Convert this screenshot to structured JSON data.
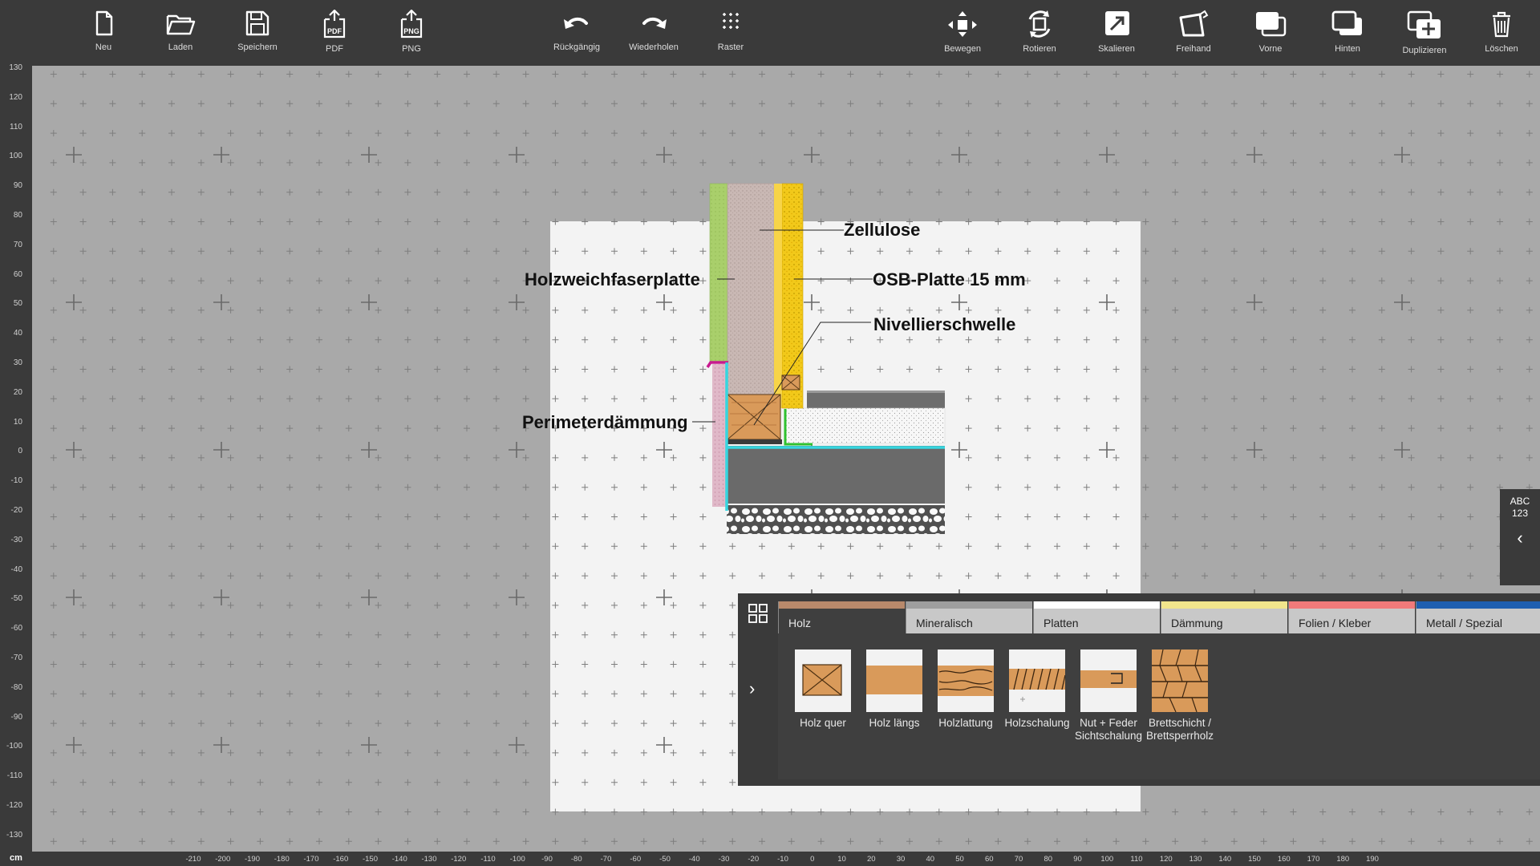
{
  "toolbar": {
    "left": [
      {
        "label": "Neu",
        "icon": "new-file-icon"
      },
      {
        "label": "Laden",
        "icon": "folder-open-icon"
      },
      {
        "label": "Speichern",
        "icon": "save-icon"
      },
      {
        "label": "PDF",
        "icon": "pdf-export-icon"
      },
      {
        "label": "PNG",
        "icon": "png-export-icon"
      }
    ],
    "middle": [
      {
        "label": "Rückgängig",
        "icon": "undo-icon"
      },
      {
        "label": "Wiederholen",
        "icon": "redo-icon"
      },
      {
        "label": "Raster",
        "icon": "grid-icon"
      }
    ],
    "right": [
      {
        "label": "Bewegen",
        "icon": "move-icon"
      },
      {
        "label": "Rotieren",
        "icon": "rotate-icon"
      },
      {
        "label": "Skalieren",
        "icon": "scale-icon"
      },
      {
        "label": "Freihand",
        "icon": "freehand-icon"
      },
      {
        "label": "Vorne",
        "icon": "bring-front-icon"
      },
      {
        "label": "Hinten",
        "icon": "send-back-icon"
      },
      {
        "label": "Duplizieren",
        "icon": "duplicate-icon"
      },
      {
        "label": "Löschen",
        "icon": "trash-icon"
      }
    ]
  },
  "ruler": {
    "unit": "cm",
    "vertical": [
      "130",
      "120",
      "110",
      "100",
      "90",
      "80",
      "70",
      "60",
      "50",
      "40",
      "30",
      "20",
      "10",
      "0",
      "-10",
      "-20",
      "-30",
      "-40",
      "-50",
      "-60",
      "-70",
      "-80",
      "-90",
      "-100",
      "-110",
      "-120",
      "-130"
    ],
    "horizontal": [
      "-210",
      "-200",
      "-190",
      "-180",
      "-170",
      "-160",
      "-150",
      "-140",
      "-130",
      "-120",
      "-110",
      "-100",
      "-90",
      "-80",
      "-70",
      "-60",
      "-50",
      "-40",
      "-30",
      "-20",
      "-10",
      "0",
      "10",
      "20",
      "30",
      "40",
      "50",
      "60",
      "70",
      "80",
      "90",
      "100",
      "110",
      "120",
      "130",
      "140",
      "150",
      "160",
      "170",
      "180",
      "190"
    ]
  },
  "drawing": {
    "labels": {
      "zellulose": "Zellulose",
      "osb": "OSB-Platte 15 mm",
      "holzweich": "Holzweichfaserplatte",
      "nivellier": "Nivellierschwelle",
      "perimeter": "Perimeterdämmung"
    }
  },
  "side_tab": {
    "line1": "ABC",
    "line2": "123",
    "arrow": "‹"
  },
  "panel": {
    "arrow": "›",
    "tabs": [
      {
        "label": "Holz",
        "color": "#b8896b",
        "active": true
      },
      {
        "label": "Mineralisch",
        "color": "#9e9e9e",
        "active": false
      },
      {
        "label": "Platten",
        "color": "#ffffff",
        "active": false
      },
      {
        "label": "Dämmung",
        "color": "#f1e58c",
        "active": false
      },
      {
        "label": "Folien / Kleber",
        "color": "#f07a7a",
        "active": false
      },
      {
        "label": "Metall / Spezial",
        "color": "#1f5fb0",
        "active": false
      }
    ],
    "items": [
      {
        "label": "Holz quer",
        "pattern": "crossed-timber"
      },
      {
        "label": "Holz längs",
        "pattern": "timber-longitudinal"
      },
      {
        "label": "Holzlattung",
        "pattern": "batten"
      },
      {
        "label": "Holzschalung",
        "pattern": "boarding"
      },
      {
        "label": "Nut + Feder Sichtschalung",
        "pattern": "tongue-groove"
      },
      {
        "label": "Brettschicht / Brettsperrholz",
        "pattern": "glulam-clt"
      }
    ]
  },
  "colors": {
    "toolbar_bg": "#3a3a3a",
    "canvas_bg": "#a9a9a9",
    "sheet_bg": "#f3f3f3",
    "holzweich": "#a9cf6b",
    "zellulose": "#c9b8b4",
    "osb": "#f2c91a",
    "perimeter": "#e0b8c8",
    "holz": "#d99a5a",
    "concrete": "#686868",
    "gravel": "#555555",
    "insulation": "#f4f4f4",
    "cyan_line": "#36d6e0",
    "green_line": "#2fc12f",
    "magenta": "#c81a8f"
  }
}
